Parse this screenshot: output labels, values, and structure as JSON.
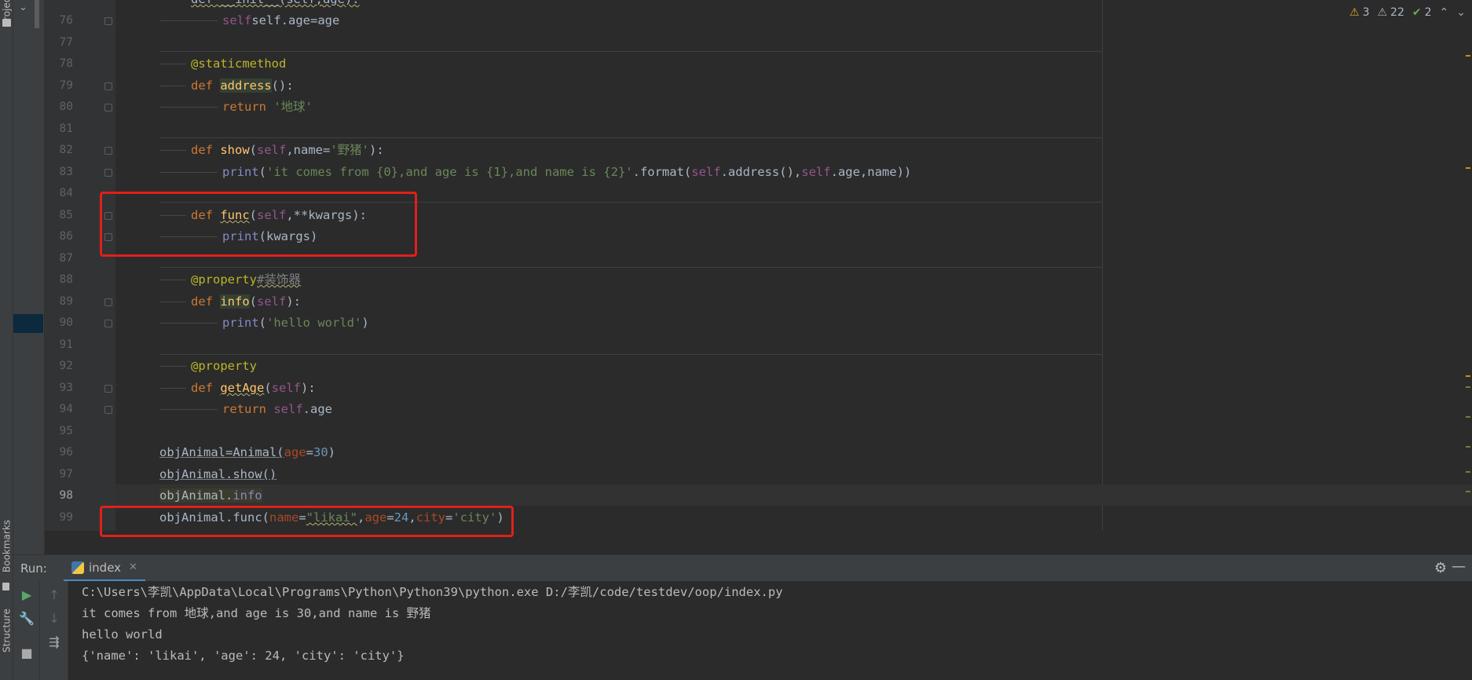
{
  "tool_strip": {
    "project_label": "Project",
    "bookmarks_label": "Bookmarks",
    "structure_label": "Structure"
  },
  "inspections": {
    "warnings": "3",
    "weak_warnings": "22",
    "typos": "2"
  },
  "code": {
    "lines": [
      {
        "n": "76"
      },
      {
        "n": "77"
      },
      {
        "n": "78"
      },
      {
        "n": "79"
      },
      {
        "n": "80"
      },
      {
        "n": "81"
      },
      {
        "n": "82"
      },
      {
        "n": "83"
      },
      {
        "n": "84"
      },
      {
        "n": "85"
      },
      {
        "n": "86"
      },
      {
        "n": "87"
      },
      {
        "n": "88"
      },
      {
        "n": "89"
      },
      {
        "n": "90"
      },
      {
        "n": "91"
      },
      {
        "n": "92"
      },
      {
        "n": "93"
      },
      {
        "n": "94"
      },
      {
        "n": "95"
      },
      {
        "n": "96"
      },
      {
        "n": "97"
      },
      {
        "n": "98"
      },
      {
        "n": "99"
      }
    ],
    "top_partial": "def __init__(self,age):",
    "l76": "self.age=age",
    "l78": "@staticmethod",
    "l79_kw": "def",
    "l79_fn": "address",
    "l79_rest": "():",
    "l80_kw": "return",
    "l80_str": "'地球'",
    "l82_kw": "def",
    "l82_fn": "show",
    "l82_a": "(",
    "l82_self": "self",
    "l82_b": ",name=",
    "l82_str": "'野猪'",
    "l82_c": "):",
    "l83_bi": "print",
    "l83_a": "(",
    "l83_str": "'it comes from {0},and age is {1},and name is {2}'",
    "l83_b": ".format(",
    "l83_self1": "self",
    "l83_c": ".address(),",
    "l83_self2": "self",
    "l83_d": ".age,name))",
    "l85_kw": "def",
    "l85_fn": "func",
    "l85_a": "(",
    "l85_self": "self",
    "l85_b": ",**kwargs):",
    "l86_bi": "print",
    "l86_rest": "(kwargs)",
    "l88_dec": "@property",
    "l88_cmt": "#装饰器",
    "l89_kw": "def",
    "l89_fn": "info",
    "l89_a": "(",
    "l89_self": "self",
    "l89_b": "):",
    "l90_bi": "print",
    "l90_a": "(",
    "l90_str": "'hello world'",
    "l90_b": ")",
    "l92_dec": "@property",
    "l93_kw": "def",
    "l93_fn": "getAge",
    "l93_a": "(",
    "l93_self": "self",
    "l93_b": "):",
    "l94_kw": "return",
    "l94_self": "self",
    "l94_rest": ".age",
    "l96_a": "objAnimal=Animal(",
    "l96_par": "age",
    "l96_eq": "=",
    "l96_num": "30",
    "l96_b": ")",
    "l97": "objAnimal.show()",
    "l98_a": "objAnimal.",
    "l98_b": "info",
    "l99_a": "objAnimal.func(",
    "l99_p1": "name",
    "l99_eq1": "=",
    "l99_s1": "\"likai\"",
    "l99_c1": ",",
    "l99_p2": "age",
    "l99_eq2": "=",
    "l99_n2": "24",
    "l99_c2": ",",
    "l99_p3": "city",
    "l99_eq3": "=",
    "l99_s3": "'city'",
    "l99_b": ")"
  },
  "run": {
    "label": "Run:",
    "tab_name": "index",
    "output": [
      "C:\\Users\\李凯\\AppData\\Local\\Programs\\Python\\Python39\\python.exe D:/李凯/code/testdev/oop/index.py",
      "it comes from 地球,and age is 30,and name is 野猪",
      "hello world",
      "{'name': 'likai', 'age': 24, 'city': 'city'}"
    ]
  }
}
